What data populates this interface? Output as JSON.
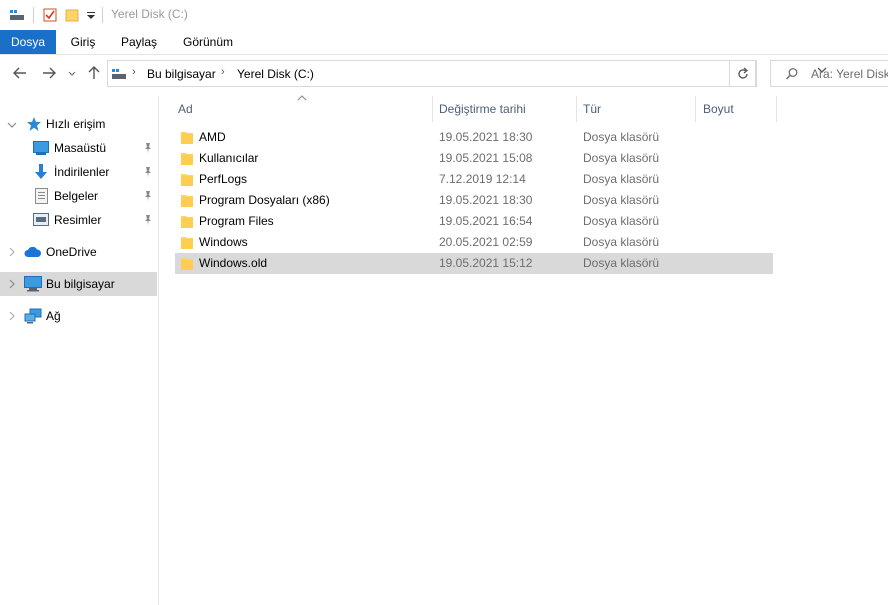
{
  "window": {
    "title": "Yerel Disk (C:)"
  },
  "ribbon": {
    "tabs": [
      {
        "label": "Dosya"
      },
      {
        "label": "Giriş"
      },
      {
        "label": "Paylaş"
      },
      {
        "label": "Görünüm"
      }
    ]
  },
  "address": {
    "breadcrumb": [
      "Bu bilgisayar",
      "Yerel Disk (C:)"
    ],
    "search_placeholder": "Ara: Yerel Disk (C:)"
  },
  "nav": {
    "quick_access": "Hızlı erişim",
    "items": [
      {
        "label": "Masaüstü",
        "icon": "desktop-icon"
      },
      {
        "label": "İndirilenler",
        "icon": "downloads-icon"
      },
      {
        "label": "Belgeler",
        "icon": "documents-icon"
      },
      {
        "label": "Resimler",
        "icon": "pictures-icon"
      }
    ],
    "onedrive": "OneDrive",
    "this_pc": "Bu bilgisayar",
    "network": "Ağ"
  },
  "columns": {
    "name": "Ad",
    "modified": "Değiştirme tarihi",
    "type": "Tür",
    "size": "Boyut"
  },
  "files": [
    {
      "name": "AMD",
      "modified": "19.05.2021 18:30",
      "type": "Dosya klasörü"
    },
    {
      "name": "Kullanıcılar",
      "modified": "19.05.2021 15:08",
      "type": "Dosya klasörü"
    },
    {
      "name": "PerfLogs",
      "modified": "7.12.2019 12:14",
      "type": "Dosya klasörü"
    },
    {
      "name": "Program Dosyaları (x86)",
      "modified": "19.05.2021 18:30",
      "type": "Dosya klasörü"
    },
    {
      "name": "Program Files",
      "modified": "19.05.2021 16:54",
      "type": "Dosya klasörü"
    },
    {
      "name": "Windows",
      "modified": "20.05.2021 02:59",
      "type": "Dosya klasörü"
    },
    {
      "name": "Windows.old",
      "modified": "19.05.2021 15:12",
      "type": "Dosya klasörü"
    }
  ],
  "colors": {
    "accent": "#1a6fc9",
    "selection": "#d9d9d9",
    "folder": "#ffd466",
    "header_text": "#4c607a"
  }
}
